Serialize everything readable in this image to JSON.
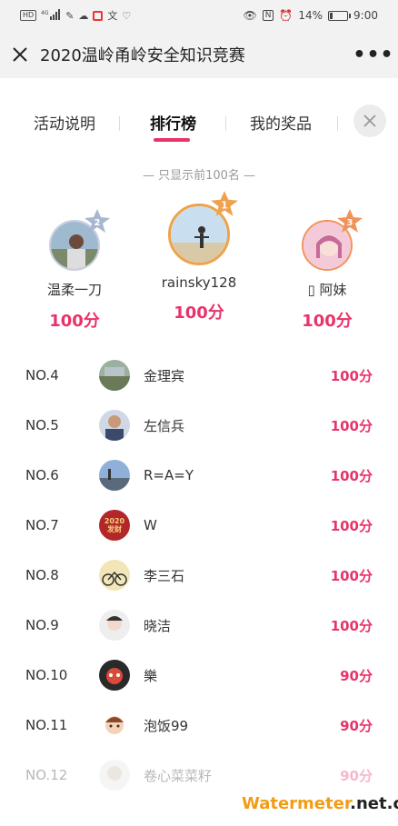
{
  "status_bar": {
    "left": "HD 4G",
    "battery_text": "14%",
    "battery_level": 0.14,
    "time": "9:00"
  },
  "title_bar": {
    "title": "2020温岭甬岭安全知识竞赛",
    "more": "•••"
  },
  "tabs": [
    {
      "label": "活动说明",
      "active": false
    },
    {
      "label": "排行榜",
      "active": true
    },
    {
      "label": "我的奖品",
      "active": false
    }
  ],
  "notice": "— 只显示前100名 —",
  "podium": [
    {
      "rank": "2",
      "name": "温柔一刀",
      "score": "100分"
    },
    {
      "rank": "1",
      "name": "rainsky128",
      "score": "100分"
    },
    {
      "rank": "3",
      "name": "▯ 阿妹",
      "score": "100分"
    }
  ],
  "leaderboard": [
    {
      "rank": "NO.4",
      "name": "金理宾",
      "score": "100分"
    },
    {
      "rank": "NO.5",
      "name": "左信兵",
      "score": "100分"
    },
    {
      "rank": "NO.6",
      "name": "R=A=Y",
      "score": "100分"
    },
    {
      "rank": "NO.7",
      "name": "W",
      "score": "100分",
      "avatar_text": "2020 发财"
    },
    {
      "rank": "NO.8",
      "name": "李三石",
      "score": "100分"
    },
    {
      "rank": "NO.9",
      "name": "晓洁",
      "score": "100分"
    },
    {
      "rank": "NO.10",
      "name": "樂",
      "score": "90分"
    },
    {
      "rank": "NO.11",
      "name": "泡饭99",
      "score": "90分"
    },
    {
      "rank": "NO.12",
      "name": "卷心菜菜籽",
      "score": "90分"
    }
  ],
  "watermark": {
    "part1": "Watermeter",
    "part2": ".net.cn"
  },
  "colors": {
    "accent": "#e8336a",
    "gold": "#f0a24a",
    "silver": "#a9b6cf",
    "bronze": "#f0935a"
  }
}
